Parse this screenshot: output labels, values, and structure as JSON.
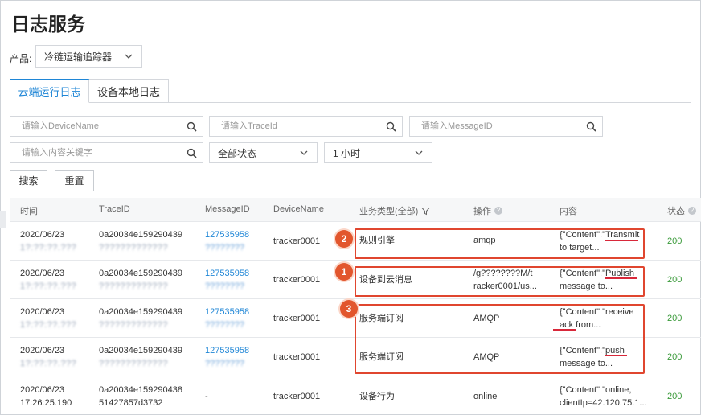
{
  "page": {
    "title": "日志服务"
  },
  "product": {
    "label": "产品:",
    "selected": "冷链运输追踪器"
  },
  "tabs": [
    {
      "label": "云端运行日志",
      "active": true
    },
    {
      "label": "设备本地日志",
      "active": false
    }
  ],
  "filters": {
    "device_name_placeholder": "请输入DeviceName",
    "trace_id_placeholder": "请输入TraceId",
    "message_id_placeholder": "请输入MessageID",
    "keyword_placeholder": "请输入内容关键字",
    "status_selected": "全部状态",
    "time_selected": "1 小时"
  },
  "actions": {
    "search_label": "搜索",
    "reset_label": "重置"
  },
  "table": {
    "columns": [
      "时间",
      "TraceID",
      "MessageID",
      "DeviceName",
      "业务类型(全部)",
      "操作",
      "内容",
      "状态"
    ],
    "rows": [
      {
        "date": "2020/06/23",
        "time_hidden": "1?:??:??.???",
        "trace1": "0a20034e159290439",
        "trace_hidden": "?????????????",
        "msgid1": "127535958",
        "msgid_hidden": "????????",
        "device": "tracker0001",
        "biz_type": "规则引擎",
        "op1": "amqp",
        "op2": "",
        "content1": "{\"Content\":\"Transmit",
        "content2": "to target...",
        "status": "200"
      },
      {
        "date": "2020/06/23",
        "time_hidden": "1?:??:??.???",
        "trace1": "0a20034e159290439",
        "trace_hidden": "?????????????",
        "msgid1": "127535958",
        "msgid_hidden": "????????",
        "device": "tracker0001",
        "biz_type": "设备到云消息",
        "op1": "/g????????M/t",
        "op2": "racker0001/us...",
        "content1": "{\"Content\":\"Publish",
        "content2": "message to...",
        "status": "200"
      },
      {
        "date": "2020/06/23",
        "time_hidden": "1?:??:??.???",
        "trace1": "0a20034e159290439",
        "trace_hidden": "?????????????",
        "msgid1": "127535958",
        "msgid_hidden": "????????",
        "device": "tracker0001",
        "biz_type": "服务端订阅",
        "op1": "AMQP",
        "op2": "",
        "content1": "{\"Content\":\"receive",
        "content2": "ack from...",
        "status": "200"
      },
      {
        "date": "2020/06/23",
        "time_hidden": "1?:??:??.???",
        "trace1": "0a20034e159290439",
        "trace_hidden": "?????????????",
        "msgid1": "127535958",
        "msgid_hidden": "????????",
        "device": "tracker0001",
        "biz_type": "服务端订阅",
        "op1": "AMQP",
        "op2": "",
        "content1": "{\"Content\":\"push",
        "content2": "message to...",
        "status": "200"
      },
      {
        "date": "2020/06/23",
        "time2": "17:26:25.190",
        "trace1": "0a20034e159290438",
        "trace2": "51427857d3732",
        "msgid1": "-",
        "device": "tracker0001",
        "biz_type": "设备行为",
        "op1": "online",
        "op2": "",
        "content1": "{\"Content\":\"online,",
        "content2": "clientIp=42.120.75.1...",
        "status": "200"
      }
    ]
  },
  "annotations": [
    {
      "number": "2"
    },
    {
      "number": "1"
    },
    {
      "number": "3"
    }
  ],
  "colors": {
    "accent": "#1f86d6",
    "highlight": "#e0462f",
    "success": "#3a9a3a"
  }
}
